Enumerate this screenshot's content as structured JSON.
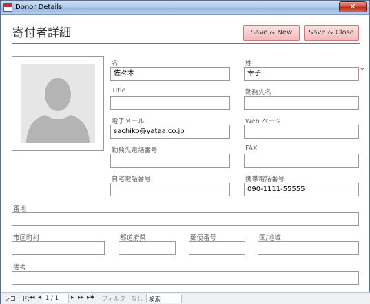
{
  "window": {
    "title": "Donor Details",
    "close_label": "✕"
  },
  "form": {
    "title": "寄付者詳細"
  },
  "buttons": {
    "save_new": "Save & New",
    "save_close": "Save & Close"
  },
  "photo": {
    "icon": "person-silhouette-icon"
  },
  "fields": {
    "first_name": {
      "label": "名",
      "value": "佐々木"
    },
    "last_name": {
      "label": "姓",
      "value": "幸子",
      "required_mark": "*"
    },
    "title": {
      "label": "Title",
      "value": ""
    },
    "company": {
      "label": "勤務先名",
      "value": ""
    },
    "email": {
      "label": "電子メール",
      "value": "sachiko@yataa.co.jp"
    },
    "web_page": {
      "label": "Web ページ",
      "value": ""
    },
    "business_phone": {
      "label": "勤務先電話番号",
      "value": ""
    },
    "fax": {
      "label": "FAX",
      "value": ""
    },
    "home_phone": {
      "label": "自宅電話番号",
      "value": ""
    },
    "mobile_phone": {
      "label": "携帯電話番号",
      "value": "090-1111-55555"
    },
    "address": {
      "label": "番地",
      "value": ""
    },
    "city": {
      "label": "市区町村",
      "value": ""
    },
    "prefecture": {
      "label": "都道府県",
      "value": ""
    },
    "zip": {
      "label": "郵便番号",
      "value": ""
    },
    "country": {
      "label": "国/地域",
      "value": ""
    },
    "notes": {
      "label": "備考",
      "value": ""
    }
  },
  "statusbar": {
    "record_label": "レコード:",
    "first": "◂◂",
    "prev": "◂",
    "position": "1 / 1",
    "next": "▸",
    "last": "▸▸",
    "new": "▸✱",
    "filter": "フィルターなし",
    "search": "検索"
  },
  "colors": {
    "accent_button": "#f5b9b9",
    "required": "#dd0000",
    "titlebar": "#a9c6e8"
  }
}
